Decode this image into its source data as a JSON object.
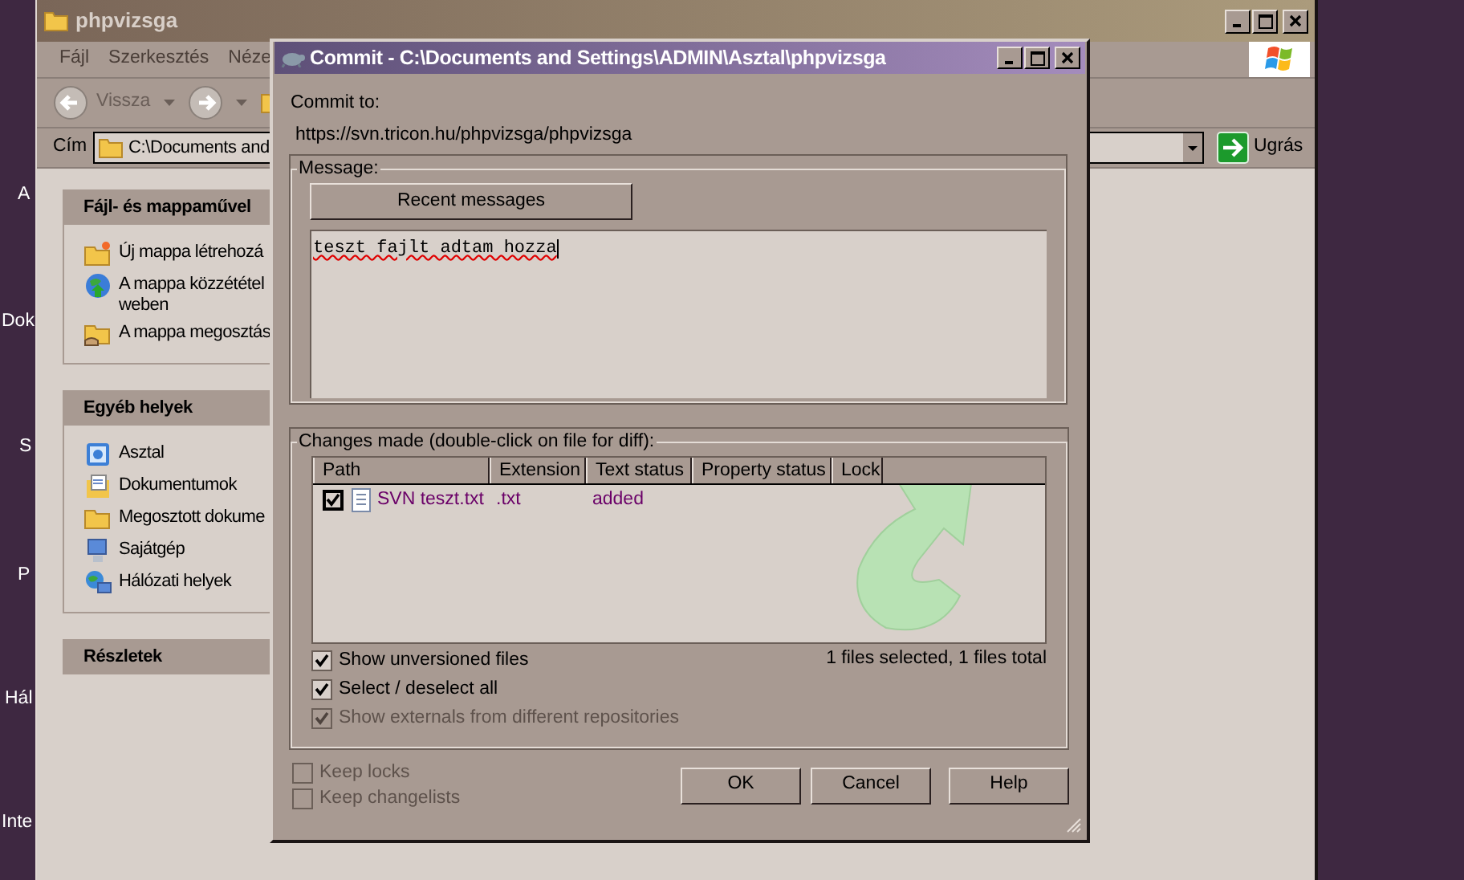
{
  "desktop_labels": [
    "A",
    "Dok",
    "S",
    "P",
    "Hál",
    "Inte"
  ],
  "explorer": {
    "title": "phpvizsga",
    "menu": [
      "Fájl",
      "Szerkesztés",
      "Néze"
    ],
    "back": "Vissza",
    "address": {
      "label": "Cím",
      "value": "C:\\Documents and",
      "go": "Ugrás"
    },
    "panels": [
      {
        "title": "Fájl- és mappaművel",
        "items": [
          "Új mappa létrehozá",
          "A mappa közzététel\nweben",
          "A mappa megosztás"
        ]
      },
      {
        "title": "Egyéb helyek",
        "items": [
          "Asztal",
          "Dokumentumok",
          "Megosztott dokume",
          "Sajátgép",
          "Hálózati helyek"
        ]
      },
      {
        "title": "Részletek"
      }
    ]
  },
  "dialog": {
    "title": "Commit - C:\\Documents and Settings\\ADMIN\\Asztal\\phpvizsga",
    "commit_to": "Commit to:",
    "url": "https://svn.tricon.hu/phpvizsga/phpvizsga",
    "message": {
      "label": "Message:",
      "recent": "Recent messages",
      "text": "teszt fajlt adtam hozza"
    },
    "changes": {
      "label": "Changes made (double-click on file for diff):",
      "columns": [
        "Path",
        "Extension",
        "Text status",
        "Property status",
        "Lock"
      ],
      "rows": [
        {
          "checked": true,
          "path": "SVN teszt.txt",
          "extension": ".txt",
          "text_status": "added"
        }
      ],
      "summary": "1 files selected, 1 files total",
      "options": [
        {
          "label": "Show unversioned files",
          "checked": true,
          "disabled": false
        },
        {
          "label": "Select / deselect all",
          "checked": true,
          "disabled": false
        },
        {
          "label": "Show externals from different repositories",
          "checked": true,
          "disabled": true
        }
      ]
    },
    "keep": [
      {
        "label": "Keep locks",
        "checked": false,
        "disabled": true
      },
      {
        "label": "Keep changelists",
        "checked": false,
        "disabled": true
      }
    ],
    "buttons": [
      "OK",
      "Cancel",
      "Help"
    ]
  }
}
